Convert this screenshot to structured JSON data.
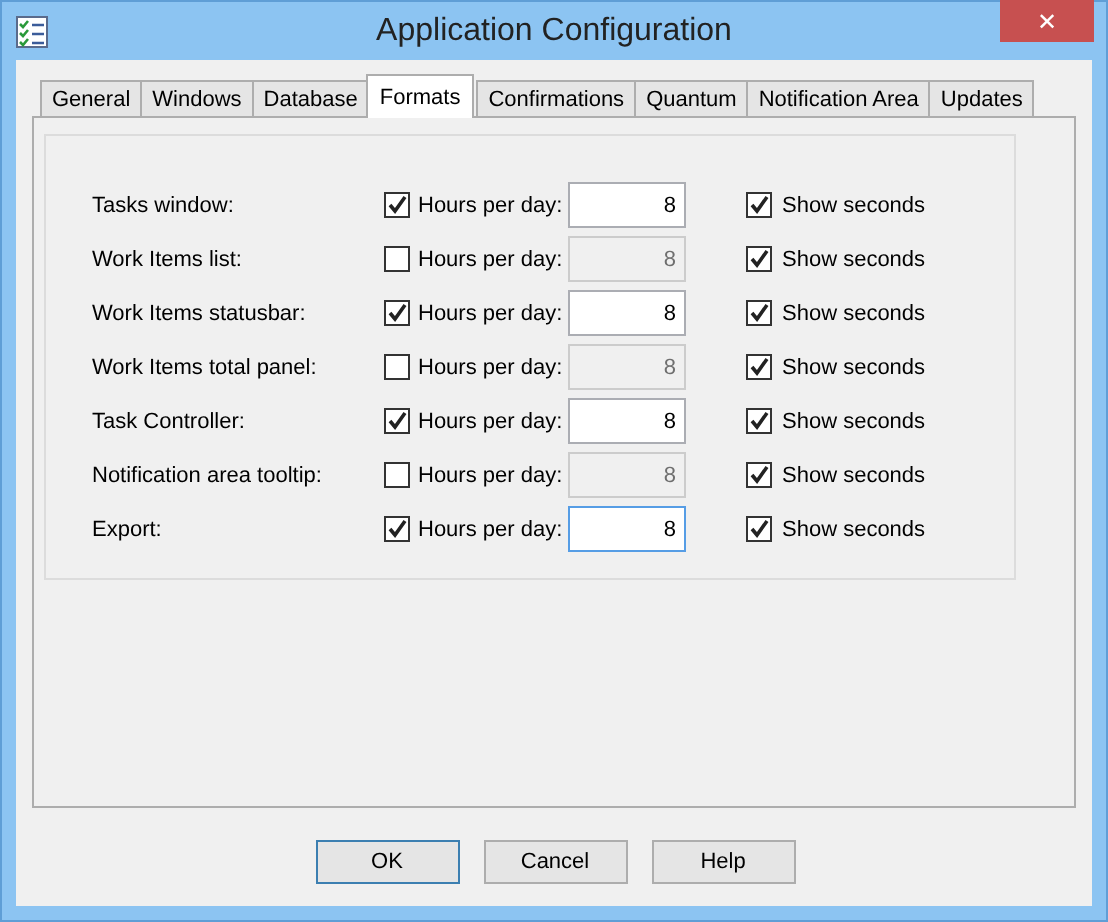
{
  "window": {
    "title": "Application Configuration",
    "close": "✕"
  },
  "tabs": [
    {
      "label": "General",
      "selected": false
    },
    {
      "label": "Windows",
      "selected": false
    },
    {
      "label": "Database",
      "selected": false
    },
    {
      "label": "Formats",
      "selected": true
    },
    {
      "label": "Confirmations",
      "selected": false
    },
    {
      "label": "Quantum",
      "selected": false
    },
    {
      "label": "Notification Area",
      "selected": false
    },
    {
      "label": "Updates",
      "selected": false
    }
  ],
  "rows": [
    {
      "label": "Tasks window:",
      "hours_checked": true,
      "hours_label": "Hours per day:",
      "value": "8",
      "focused": false,
      "show_checked": true,
      "show_label": "Show seconds"
    },
    {
      "label": "Work Items list:",
      "hours_checked": false,
      "hours_label": "Hours per day:",
      "value": "8",
      "focused": false,
      "show_checked": true,
      "show_label": "Show seconds"
    },
    {
      "label": "Work Items statusbar:",
      "hours_checked": true,
      "hours_label": "Hours per day:",
      "value": "8",
      "focused": false,
      "show_checked": true,
      "show_label": "Show seconds"
    },
    {
      "label": "Work Items total panel:",
      "hours_checked": false,
      "hours_label": "Hours per day:",
      "value": "8",
      "focused": false,
      "show_checked": true,
      "show_label": "Show seconds"
    },
    {
      "label": "Task Controller:",
      "hours_checked": true,
      "hours_label": "Hours per day:",
      "value": "8",
      "focused": false,
      "show_checked": true,
      "show_label": "Show seconds"
    },
    {
      "label": "Notification area tooltip:",
      "hours_checked": false,
      "hours_label": "Hours per day:",
      "value": "8",
      "focused": false,
      "show_checked": true,
      "show_label": "Show seconds"
    },
    {
      "label": "Export:",
      "hours_checked": true,
      "hours_label": "Hours per day:",
      "value": "8",
      "focused": true,
      "show_checked": true,
      "show_label": "Show seconds"
    }
  ],
  "buttons": [
    {
      "label": "OK",
      "default": true
    },
    {
      "label": "Cancel",
      "default": false
    },
    {
      "label": "Help",
      "default": false
    }
  ]
}
